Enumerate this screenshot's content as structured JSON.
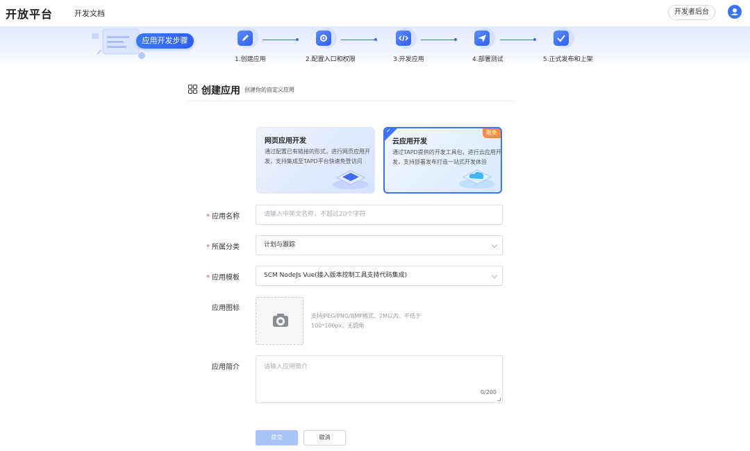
{
  "header": {
    "logo": "开放平台",
    "nav_docs": "开发文档",
    "console_button": "开发者后台"
  },
  "banner": {
    "pill": "应用开发步骤",
    "steps": [
      {
        "label": "1.创建应用",
        "icon": "edit-icon"
      },
      {
        "label": "2.配置入口和权限",
        "icon": "settings-icon"
      },
      {
        "label": "3.开发应用",
        "icon": "code-icon"
      },
      {
        "label": "4.部署测试",
        "icon": "send-icon"
      },
      {
        "label": "5.正式发布和上架",
        "icon": "check-icon"
      }
    ]
  },
  "section": {
    "title": "创建应用",
    "subtitle": "创建你的自定义应用"
  },
  "cards": {
    "web": {
      "title": "网页应用开发",
      "desc": "通过配置已有链接的形式，进行网页应用开发，支持集成至TAPD平台快速免登访问"
    },
    "cloud": {
      "title": "云应用开发",
      "desc": "通过TAPD提供的开发工具包，进行云应用开发，支持部署发布打造一站式开发体验",
      "badge": "限免",
      "selected": true
    }
  },
  "form": {
    "name_label": "应用名称",
    "name_placeholder": "请输入中英文名称，不超过20个字符",
    "category_label": "所属分类",
    "category_value": "计划与跟踪",
    "template_label": "应用模板",
    "template_value": "SCM NodeJs Vue(接入版本控制工具支持代码集成)",
    "icon_label": "应用图标",
    "icon_hint": "支持JPEG/PNG/BMP格式、2M以内、不低于100*100px、无圆角",
    "intro_label": "应用简介",
    "intro_placeholder": "请输入应用简介",
    "intro_counter": "0/200",
    "required_mark": "*"
  },
  "actions": {
    "submit": "提交",
    "cancel": "取消"
  },
  "colors": {
    "primary": "#2f5ff0",
    "badge": "#f78d45",
    "required": "#e5484d"
  }
}
